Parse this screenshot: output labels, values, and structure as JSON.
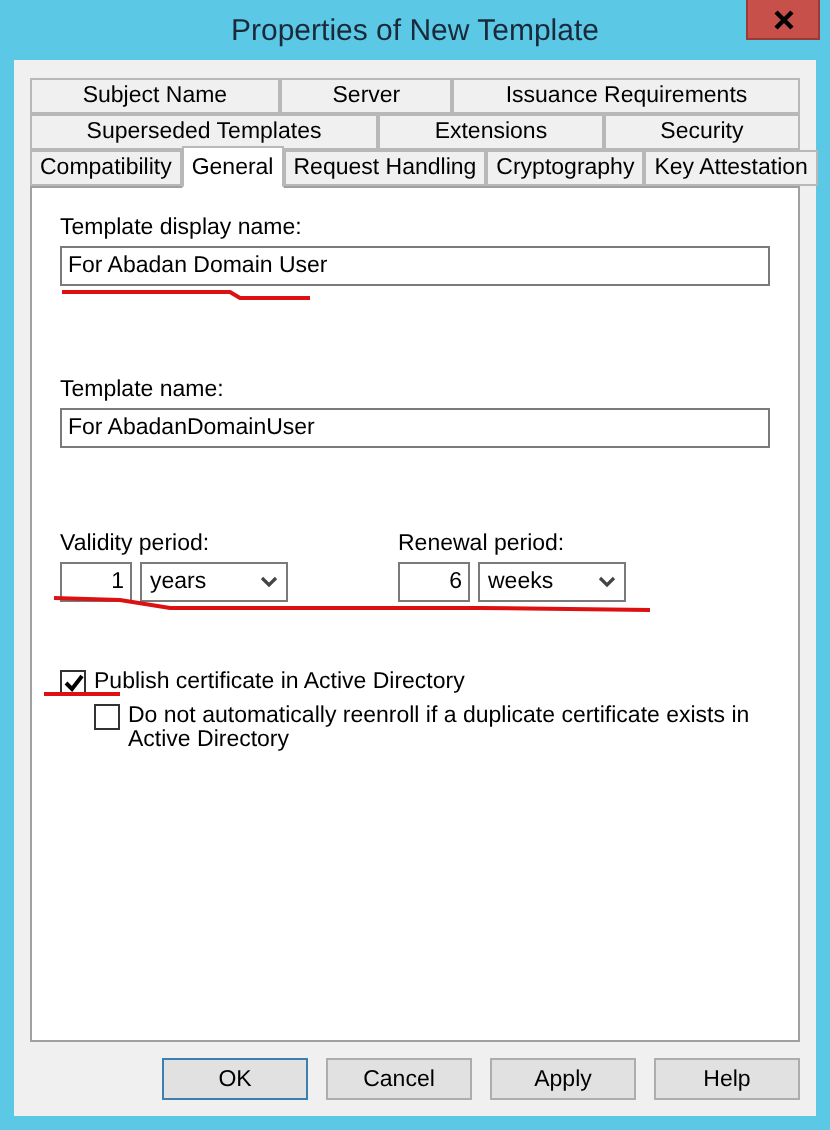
{
  "window": {
    "title": "Properties of New Template"
  },
  "tab_rows": [
    [
      {
        "label": "Subject Name",
        "selected": false
      },
      {
        "label": "Server",
        "selected": false
      },
      {
        "label": "Issuance Requirements",
        "selected": false
      }
    ],
    [
      {
        "label": "Superseded Templates",
        "selected": false
      },
      {
        "label": "Extensions",
        "selected": false
      },
      {
        "label": "Security",
        "selected": false
      }
    ],
    [
      {
        "label": "Compatibility",
        "selected": false
      },
      {
        "label": "General",
        "selected": true
      },
      {
        "label": "Request Handling",
        "selected": false
      },
      {
        "label": "Cryptography",
        "selected": false
      },
      {
        "label": "Key Attestation",
        "selected": false
      }
    ]
  ],
  "display_name": {
    "label": "Template display name:",
    "value": "For Abadan Domain User"
  },
  "template_name": {
    "label": "Template name:",
    "value": "For AbadanDomainUser"
  },
  "validity_period": {
    "label": "Validity period:",
    "number": "1",
    "unit": "years"
  },
  "renewal_period": {
    "label": "Renewal period:",
    "number": "6",
    "unit": "weeks"
  },
  "checkboxes": [
    {
      "label": "Publish certificate in Active Directory",
      "checked": true,
      "children": [
        {
          "label": "Do not automatically reenroll if a duplicate certificate exists in Active Directory",
          "checked": false
        }
      ]
    }
  ],
  "buttons": [
    "OK",
    "Cancel",
    "Apply",
    "Help"
  ]
}
